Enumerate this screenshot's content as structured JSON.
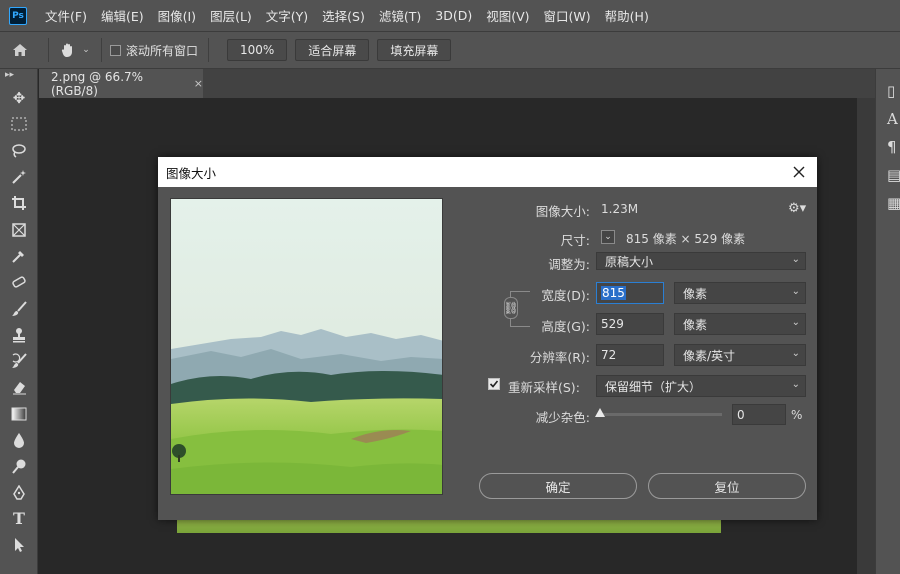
{
  "app": {
    "logo_text": "Ps",
    "menu": [
      "文件(F)",
      "编辑(E)",
      "图像(I)",
      "图层(L)",
      "文字(Y)",
      "选择(S)",
      "滤镜(T)",
      "3D(D)",
      "视图(V)",
      "窗口(W)",
      "帮助(H)"
    ]
  },
  "options_bar": {
    "scroll_all_label": "滚动所有窗口",
    "zoom_label": "100%",
    "fit_screen_label": "适合屏幕",
    "fill_screen_label": "填充屏幕"
  },
  "document": {
    "tab_title": "2.png @ 66.7%(RGB/8)",
    "close_glyph": "×"
  },
  "dialog": {
    "title": "图像大小",
    "image_size_label": "图像大小:",
    "image_size_value": "1.23M",
    "dimensions_label": "尺寸:",
    "dimensions_value": "815 像素 × 529 像素",
    "fit_to_label": "调整为:",
    "fit_to_value": "原稿大小",
    "width_label": "宽度(D):",
    "width_value": "815",
    "width_unit": "像素",
    "height_label": "高度(G):",
    "height_value": "529",
    "height_unit": "像素",
    "resolution_label": "分辨率(R):",
    "resolution_value": "72",
    "resolution_unit": "像素/英寸",
    "resample_label": "重新采样(S):",
    "resample_checked": true,
    "resample_value": "保留细节（扩大）",
    "noise_label": "减少杂色:",
    "noise_value": "0",
    "noise_unit": "%",
    "ok_label": "确定",
    "reset_label": "复位"
  }
}
